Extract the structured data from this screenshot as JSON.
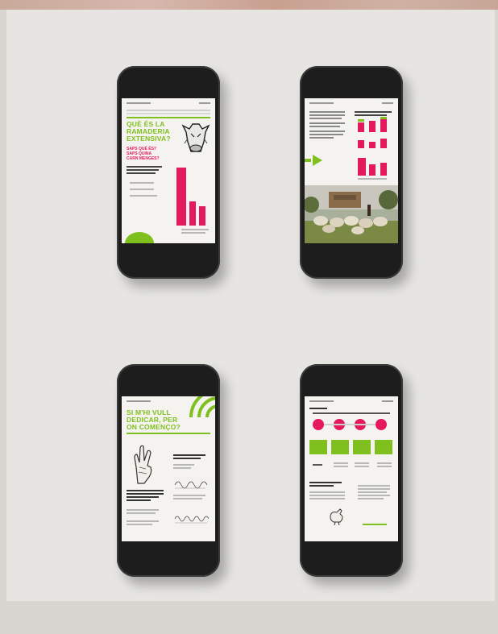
{
  "screens": [
    {
      "id": "screen1",
      "title": "QUÈ ÉS LA\nRAMADERIA\nEXTENSIVA?",
      "subtitle": "SAPS QUÈ ÉS?\nSAPS QUINA\nCARN MENGES?"
    },
    {
      "id": "screen2"
    },
    {
      "id": "screen3",
      "title": "SI M'HI VULL\nDEDICAR, PER\nON COMENÇO?"
    },
    {
      "id": "screen4"
    }
  ],
  "colors": {
    "accent_green": "#7fbf1e",
    "accent_pink": "#e5195e",
    "phone_body": "#1d1d1d",
    "background": "#e6e5e2"
  },
  "icons": [
    "cow-illustration-icon",
    "sheep-photo",
    "crossed-fingers-illustration-icon",
    "chicken-illustration-icon"
  ]
}
